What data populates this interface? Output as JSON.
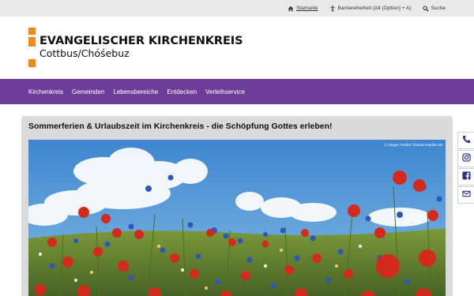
{
  "topbar": {
    "links": [
      {
        "icon": "home-icon",
        "label": "Startseite",
        "active": true
      },
      {
        "icon": "accessibility-icon",
        "label": "Barrierefreiheit (Alt (Option) + A)",
        "active": false
      },
      {
        "icon": "search-icon",
        "label": "Suche",
        "active": false
      }
    ]
  },
  "logo": {
    "title": "EVANGELISCHER KIRCHENKREIS",
    "subtitle": "Cottbus/Chóśebuz",
    "accent_color": "#f08a1a"
  },
  "nav": {
    "color": "#6e3d9a",
    "items": [
      "Kirchenkreis",
      "Gemeinden",
      "Lebensbereiche",
      "Entdecken",
      "Verleihservice"
    ]
  },
  "article": {
    "title": "Sommerferien & Urlaubszeit im Kirchenkreis - die Schöpfung Gottes erleben!",
    "image_credit": "© Jürgen Treiber / fundus-medien.de"
  },
  "social": {
    "icons": [
      "phone-icon",
      "instagram-icon",
      "facebook-icon",
      "mail-icon"
    ]
  }
}
